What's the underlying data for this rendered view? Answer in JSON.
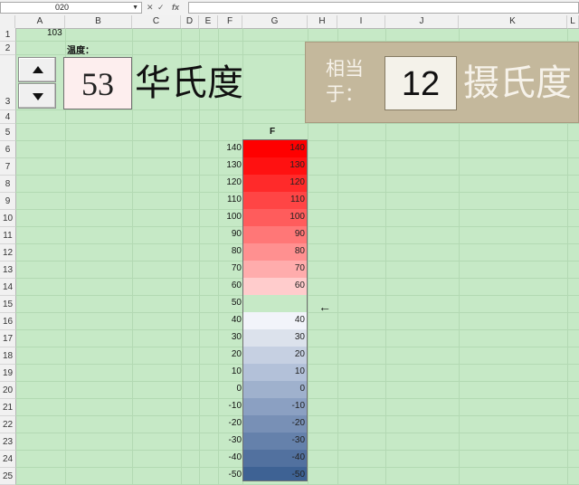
{
  "formula_bar": {
    "name_box": "020",
    "fx_symbol": "fx",
    "btn_cancel": "✕",
    "btn_confirm": "✓",
    "formula": ""
  },
  "columns": [
    "A",
    "B",
    "C",
    "D",
    "E",
    "F",
    "G",
    "H",
    "I",
    "J",
    "K",
    "L"
  ],
  "rows": [
    "1",
    "2",
    "3",
    "4",
    "5",
    "6",
    "7",
    "8",
    "9",
    "10",
    "11",
    "12",
    "13",
    "14",
    "15",
    "16",
    "17",
    "18",
    "19",
    "20",
    "21",
    "22",
    "23",
    "24",
    "25"
  ],
  "cells": {
    "a1": "103"
  },
  "temp_label": "温度：",
  "fahrenheit": {
    "value": "53",
    "unit": "华氏度"
  },
  "celsius": {
    "prefix": "相当于：",
    "value": "12",
    "unit": "摄氏度"
  },
  "thermometer": {
    "header": "F",
    "bands": [
      {
        "left": "140",
        "right": "140",
        "color": "#ff0000"
      },
      {
        "left": "130",
        "right": "130",
        "color": "#ff1111"
      },
      {
        "left": "120",
        "right": "120",
        "color": "#ff2a2a"
      },
      {
        "left": "110",
        "right": "110",
        "color": "#ff4545"
      },
      {
        "left": "100",
        "right": "100",
        "color": "#ff5c5c"
      },
      {
        "left": "90",
        "right": "90",
        "color": "#ff7777"
      },
      {
        "left": "80",
        "right": "80",
        "color": "#ff9090"
      },
      {
        "left": "70",
        "right": "70",
        "color": "#ffacac"
      },
      {
        "left": "60",
        "right": "60",
        "color": "#ffcccc"
      },
      {
        "left": "50",
        "right": "",
        "color": "#c6e9c6"
      },
      {
        "left": "40",
        "right": "40",
        "color": "#f2f4fa"
      },
      {
        "left": "30",
        "right": "30",
        "color": "#dce2ec"
      },
      {
        "left": "20",
        "right": "20",
        "color": "#c6d0e2"
      },
      {
        "left": "10",
        "right": "10",
        "color": "#b3c1d9"
      },
      {
        "left": "0",
        "right": "0",
        "color": "#9fb1cd"
      },
      {
        "left": "-10",
        "right": "-10",
        "color": "#8ba0c2"
      },
      {
        "left": "-20",
        "right": "-20",
        "color": "#7890b6"
      },
      {
        "left": "-30",
        "right": "-30",
        "color": "#6581ab"
      },
      {
        "left": "-40",
        "right": "-40",
        "color": "#52719f"
      },
      {
        "left": "-50",
        "right": "-50",
        "color": "#3e6294"
      }
    ],
    "marker": "←"
  }
}
